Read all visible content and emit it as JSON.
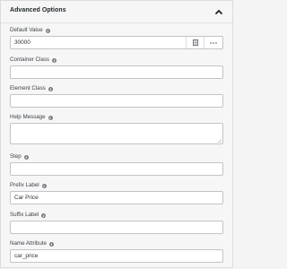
{
  "section": {
    "title": "Advanced Options"
  },
  "fields": {
    "default_value": {
      "label": "Default Value",
      "value": "30000"
    },
    "container_class": {
      "label": "Container Class",
      "value": ""
    },
    "element_class": {
      "label": "Element Class",
      "value": ""
    },
    "help_message": {
      "label": "Help Message",
      "value": ""
    },
    "step": {
      "label": "Step",
      "value": ""
    },
    "prefix_label": {
      "label": "Prefix Label",
      "value": "Car Price"
    },
    "suffix_label": {
      "label": "Suffix Label",
      "value": ""
    },
    "name_attribute": {
      "label": "Name Attribute",
      "value": "car_price"
    }
  },
  "icons": {
    "collapse": "chevron-up-icon",
    "info": "info-icon",
    "shortcodes": "document-list-icon",
    "more": "ellipsis-icon"
  },
  "colors": {
    "panel_bg": "#f6f6f6",
    "input_border": "#c3c4c7",
    "text": "#3c434a"
  }
}
